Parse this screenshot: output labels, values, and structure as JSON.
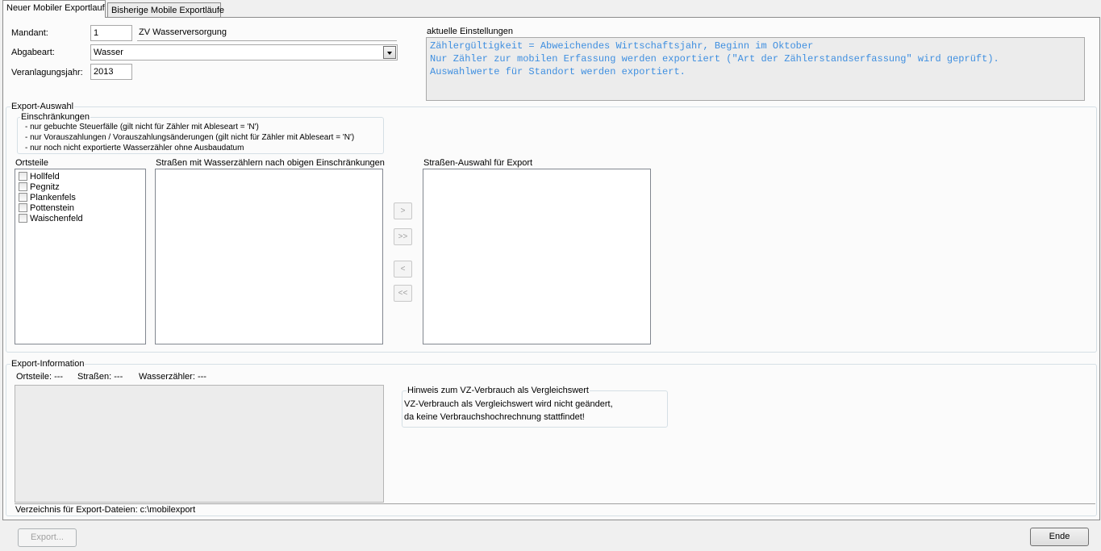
{
  "tabs": [
    {
      "label": "Neuer Mobiler Exportlauf",
      "active": true
    },
    {
      "label": "Bisherige Mobile Exportläufe",
      "active": false
    }
  ],
  "header": {
    "mandant_label": "Mandant:",
    "mandant_value": "1",
    "mandant_name": "ZV Wasserversorgung",
    "abgabeart_label": "Abgabeart:",
    "abgabeart_value": "Wasser",
    "jahr_label": "Veranlagungsjahr:",
    "jahr_value": "2013"
  },
  "settings": {
    "title": "aktuelle Einstellungen",
    "lines": [
      "Zählergültigkeit = Abweichendes Wirtschaftsjahr, Beginn im Oktober",
      "Nur Zähler zur mobilen Erfassung werden exportiert (\"Art der Zählerstandserfassung\" wird geprüft).",
      "Auswahlwerte für Standort werden exportiert."
    ],
    "text_color": "#3f8fe0"
  },
  "export_auswahl": {
    "title": "Export-Auswahl",
    "einschraenkungen_title": "Einschränkungen",
    "einschraenkungen": [
      "- nur gebuchte Steuerfälle (gilt nicht für Zähler mit Ableseart = 'N')",
      "- nur Vorauszahlungen / Vorauszahlungsänderungen (gilt nicht für Zähler mit Ableseart = 'N')",
      "- nur noch nicht exportierte Wasserzähler ohne Ausbaudatum"
    ],
    "ortsteile_label": "Ortsteile",
    "ortsteile": [
      "Hollfeld",
      "Pegnitz",
      "Plankenfels",
      "Pottenstein",
      "Waischenfeld"
    ],
    "strassen_label": "Straßen mit Wasserzählern nach obigen Einschränkungen",
    "auswahl_label": "Straßen-Auswahl für Export",
    "btn_add": ">",
    "btn_add_all": ">>",
    "btn_remove": "<",
    "btn_remove_all": "<<"
  },
  "export_info": {
    "title": "Export-Information",
    "ortsteile": "Ortsteile:  ---",
    "strassen": "Straßen:  ---",
    "wasserzaehler": "Wasserzähler:  ---",
    "hinweis_title": "Hinweis zum VZ-Verbrauch als Vergleichswert",
    "hinweis_line1": "VZ-Verbrauch als Vergleichswert wird nicht geändert,",
    "hinweis_line2": "da keine Verbrauchshochrechnung stattfindet!",
    "verzeichnis": "Verzeichnis für Export-Dateien: c:\\mobilexport"
  },
  "footer": {
    "export_label": "Export...",
    "ende_label": "Ende"
  }
}
